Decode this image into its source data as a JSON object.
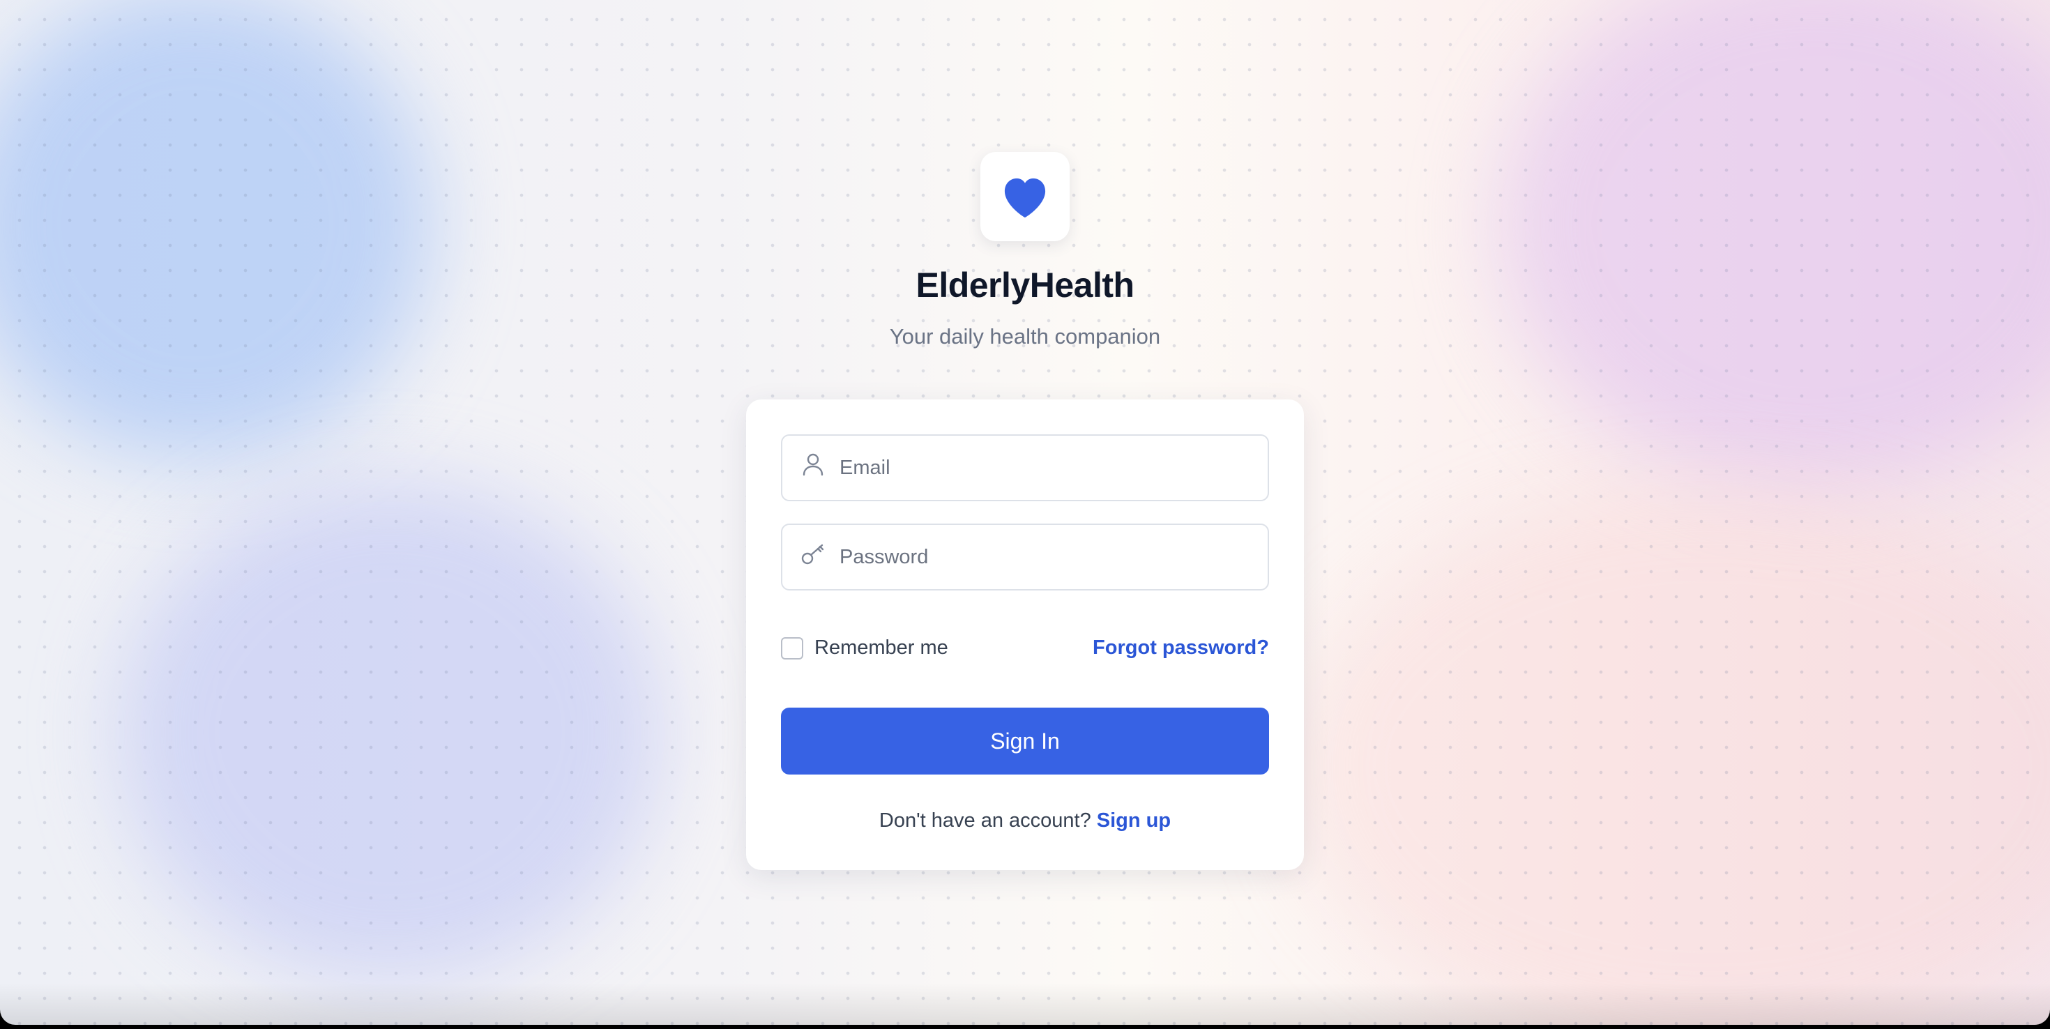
{
  "brand": {
    "title": "ElderlyHealth",
    "subtitle": "Your daily health companion",
    "logo_icon": "heart-icon",
    "accent_color": "#3762e4"
  },
  "login_form": {
    "email_placeholder": "Email",
    "email_icon": "user-icon",
    "password_placeholder": "Password",
    "password_icon": "key-icon",
    "remember_label": "Remember me",
    "remember_checked": false,
    "forgot_label": "Forgot password?",
    "submit_label": "Sign In",
    "signup_prompt": "Don't have an account?",
    "signup_label": "Sign up"
  }
}
